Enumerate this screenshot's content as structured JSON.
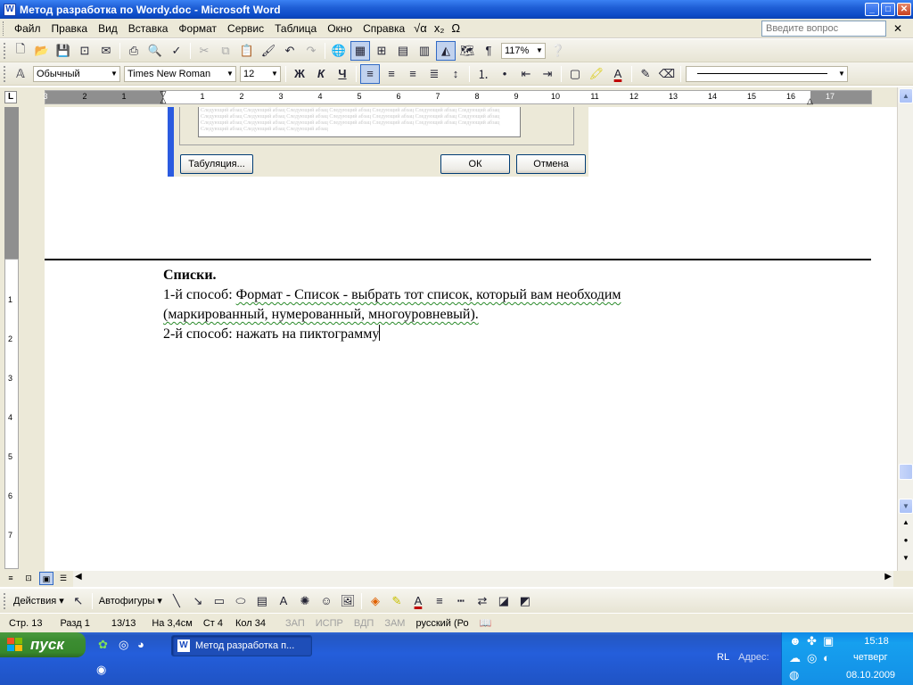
{
  "window": {
    "title": "Метод разработка по Wordy.doc - Microsoft Word",
    "app_icon": "W",
    "min": "_",
    "max": "□",
    "close": "✕"
  },
  "menu": {
    "items": [
      "Файл",
      "Правка",
      "Вид",
      "Вставка",
      "Формат",
      "Сервис",
      "Таблица",
      "Окно",
      "Справка"
    ],
    "help_placeholder": "Введите вопрос",
    "help_close": "✕",
    "equation_icon": "√α",
    "subscript_icon": "x₂",
    "omega_icon": "Ω"
  },
  "standard_toolbar": {
    "zoom": "117%",
    "pilcrow": "¶"
  },
  "format_toolbar": {
    "style": "Обычный",
    "font": "Times New Roman",
    "size": "12",
    "bold": "Ж",
    "italic": "К",
    "underline": "Ч"
  },
  "ruler": {
    "corner": "L",
    "numbers": [
      "3",
      "2",
      "1",
      "1",
      "2",
      "3",
      "4",
      "5",
      "6",
      "7",
      "8",
      "9",
      "10",
      "11",
      "12",
      "13",
      "14",
      "15",
      "16",
      "17"
    ],
    "vnumbers": [
      "1",
      "2",
      "3",
      "4",
      "5",
      "6",
      "7"
    ]
  },
  "embedded_dialog": {
    "tabs_button": "Табуляция...",
    "ok_button": "ОК",
    "cancel_button": "Отмена",
    "preview_text": "Следующий абзац Следующий абзац Следующий абзац Следующий абзац Следующий абзац Следующий абзац Следующий абзац Следующий абзац Следующий абзац Следующий абзац Следующий абзац Следующий абзац Следующий абзац Следующий абзац Следующий абзац Следующий абзац Следующий абзац Следующий абзац Следующий абзац Следующий абзац Следующий абзац Следующий абзац Следующий абзац Следующий абзац"
  },
  "document": {
    "heading": "Списки.",
    "line1_prefix": "1-й способ: ",
    "line1_rest": "Формат - Список - выбрать тот список, который вам необходим",
    "line2": "(маркированный, нумерованный, многоуровневый).",
    "line3": "2-й способ: нажать на пиктограмму"
  },
  "drawing_toolbar": {
    "actions": "Действия",
    "autoshapes": "Автофигуры"
  },
  "status": {
    "page": "Стр. 13",
    "section": "Разд 1",
    "pages": "13/13",
    "at": "На 3,4см",
    "line": "Ст 4",
    "col": "Кол 34",
    "rec": "ЗАП",
    "trk": "ИСПР",
    "ext": "ВДП",
    "ovr": "ЗАМ",
    "lang": "русский (Ро"
  },
  "taskbar": {
    "start": "пуск",
    "task": "Метод разработка п...",
    "lang": "RL",
    "address": "Адрес:",
    "time": "15:18",
    "day": "четверг",
    "date": "08.10.2009"
  }
}
